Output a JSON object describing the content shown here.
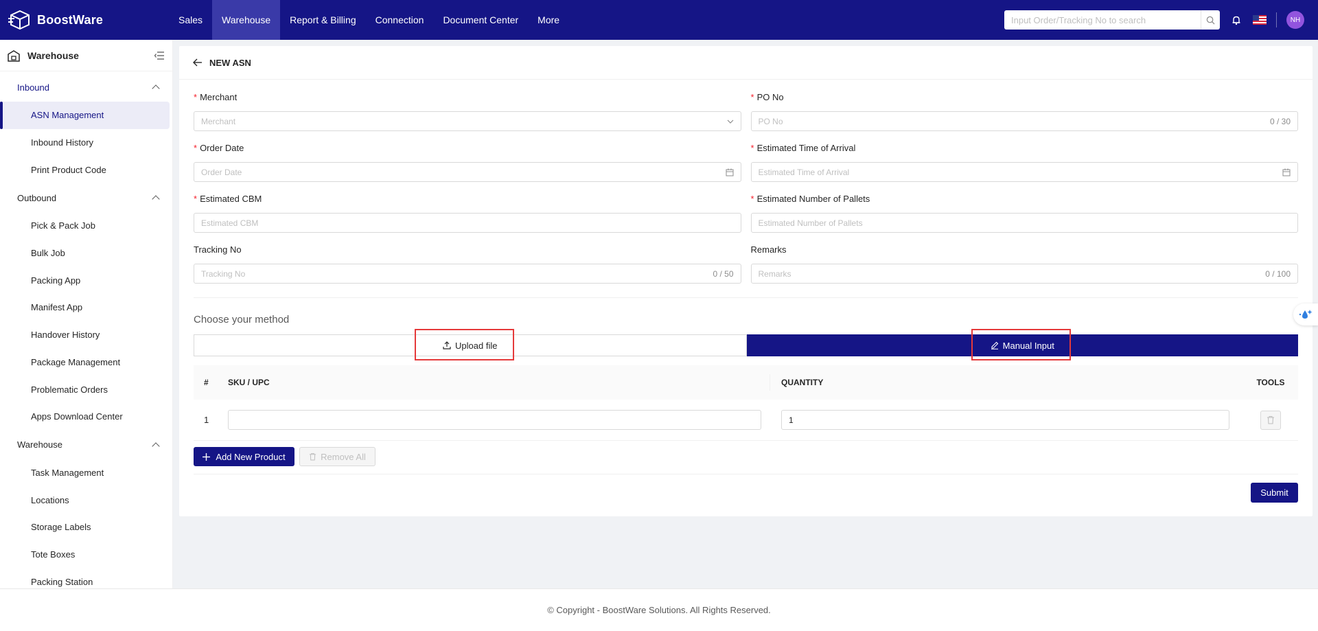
{
  "app": {
    "name": "BoostWare"
  },
  "nav": [
    {
      "label": "Sales",
      "active": false
    },
    {
      "label": "Warehouse",
      "active": true
    },
    {
      "label": "Report & Billing",
      "active": false
    },
    {
      "label": "Connection",
      "active": false
    },
    {
      "label": "Document Center",
      "active": false
    },
    {
      "label": "More",
      "active": false
    }
  ],
  "search": {
    "placeholder": "Input Order/Tracking No to search"
  },
  "user": {
    "initials": "NH"
  },
  "sidebar": {
    "title": "Warehouse",
    "groups": [
      {
        "label": "Inbound",
        "items": [
          "ASN Management",
          "Inbound History",
          "Print Product Code"
        ]
      },
      {
        "label": "Outbound",
        "items": [
          "Pick & Pack Job",
          "Bulk Job",
          "Packing App",
          "Manifest App",
          "Handover History",
          "Package Management",
          "Problematic Orders",
          "Apps Download Center"
        ]
      },
      {
        "label": "Warehouse",
        "items": [
          "Task Management",
          "Locations",
          "Storage Labels",
          "Tote Boxes",
          "Packing Station"
        ]
      }
    ],
    "active_item": "ASN Management"
  },
  "page": {
    "title": "NEW ASN"
  },
  "form": {
    "merchant": {
      "label": "Merchant",
      "placeholder": "Merchant",
      "required": true
    },
    "po_no": {
      "label": "PO No",
      "placeholder": "PO No",
      "required": true,
      "count": "0 / 30"
    },
    "order_date": {
      "label": "Order Date",
      "placeholder": "Order Date",
      "required": true
    },
    "eta": {
      "label": "Estimated Time of Arrival",
      "placeholder": "Estimated Time of Arrival",
      "required": true
    },
    "cbm": {
      "label": "Estimated CBM",
      "placeholder": "Estimated CBM",
      "required": true
    },
    "pallets": {
      "label": "Estimated Number of Pallets",
      "placeholder": "Estimated Number of Pallets",
      "required": true
    },
    "tracking": {
      "label": "Tracking No",
      "placeholder": "Tracking No",
      "required": false,
      "count": "0 / 50"
    },
    "remarks": {
      "label": "Remarks",
      "placeholder": "Remarks",
      "required": false,
      "count": "0 / 100"
    }
  },
  "method": {
    "title": "Choose your method",
    "upload_label": "Upload file",
    "manual_label": "Manual Input",
    "selected": "Manual Input"
  },
  "table": {
    "columns": {
      "index": "#",
      "sku": "SKU / UPC",
      "quantity": "QUANTITY",
      "tools": "TOOLS"
    },
    "rows": [
      {
        "index": "1",
        "sku": "",
        "quantity": "1"
      }
    ]
  },
  "buttons": {
    "add_product": "Add New Product",
    "remove_all": "Remove All",
    "submit": "Submit"
  },
  "footer": {
    "text": "© Copyright - BoostWare Solutions. All Rights Reserved."
  },
  "colors": {
    "brand": "#151586",
    "highlight": "#e5393a",
    "required": "#f5222d"
  }
}
